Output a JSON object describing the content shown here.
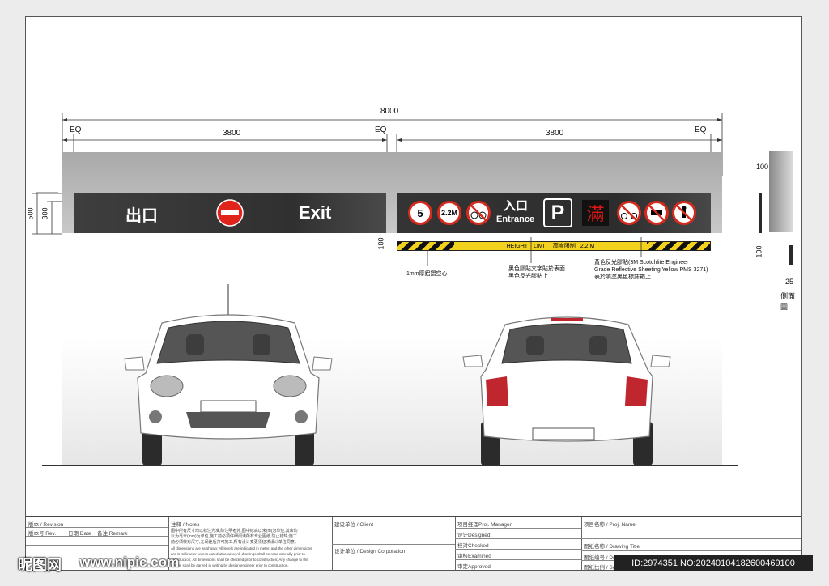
{
  "dimensions": {
    "total": "8000",
    "left_span": "3800",
    "right_span": "3800",
    "eq_left": "EQ",
    "eq_mid": "EQ",
    "eq_right": "EQ",
    "panel_height_outer": "500",
    "panel_height_inner": "300",
    "bar_height": "100",
    "side_top": "100",
    "side_bottom": "100",
    "side_thickness": "25"
  },
  "exit_sign": {
    "chinese": "出口",
    "english": "Exit"
  },
  "entrance_sign": {
    "speed_limit": "5",
    "height_limit": "2.2M",
    "chinese": "入口",
    "english": "Entrance",
    "parking": "P",
    "full": "滿"
  },
  "height_bar": {
    "label": "HEIGHT　LIMIT",
    "cn_label": "高度限制",
    "value": "2.2 M"
  },
  "notes": {
    "n1": "1mm厚鋁摺空心",
    "n2a": "黑色膠貼文字貼於表面",
    "n2b": "黑色反光膠貼上",
    "n3a": "黃色反光膠貼(3M Scotchlite Engineer",
    "n3b": "Grade Reflective Sheeting Yellow PMS 3271)",
    "n3c": "表於噴塗黑色標誌箱上"
  },
  "side_view_label": "側面圖",
  "title_block": {
    "revision": "版本 / Revision",
    "rev_no": "版本号 Rev.",
    "date": "日期 Date",
    "remark": "备注 Remark",
    "notes_title": "注释 / Notes",
    "notes_cn1": "图中所有尺寸均以标注为准,除注明者外,图中标高以米(m)为单位,其余均",
    "notes_cn2": "以为毫米(mm)为单位,施工前必须仔细阅读所有专业图纸,防止错缺;施工",
    "notes_cn3": "前必须核对尺寸,无误差后方可施工,所有设计变更须征求设计单位同意。",
    "notes_en1": "All dimensions are as shown; All levels are indicated in meter, and the other dimensions",
    "notes_en2": "are in millimeter unless noted otherwise; All drawings shall be read carefully prior to",
    "notes_en3": "construction; All dimensions shall be checked prior to construction; Any change to the",
    "notes_en4": "design shall be agreed in writing by design engineer prior to construction.",
    "client": "建设单位 / Client",
    "design_corp": "设计单位 / Design Corporation",
    "proj_manager": "项目经理Proj. Manager",
    "designed": "设计Designed",
    "checked": "校对Checked",
    "examined": "审核Examined",
    "approved": "审定Approved",
    "proj_name": "项目名称 / Proj. Name",
    "drawing_title": "图纸名称 / Drawing Title",
    "drawing_number": "图纸编号 / Drawing Number",
    "scale": "图纸比例 / Scale"
  },
  "watermark": {
    "logo": "昵图网",
    "url": "www.nipic.com",
    "id": "ID:2974351 NO:20240104182600469100"
  }
}
